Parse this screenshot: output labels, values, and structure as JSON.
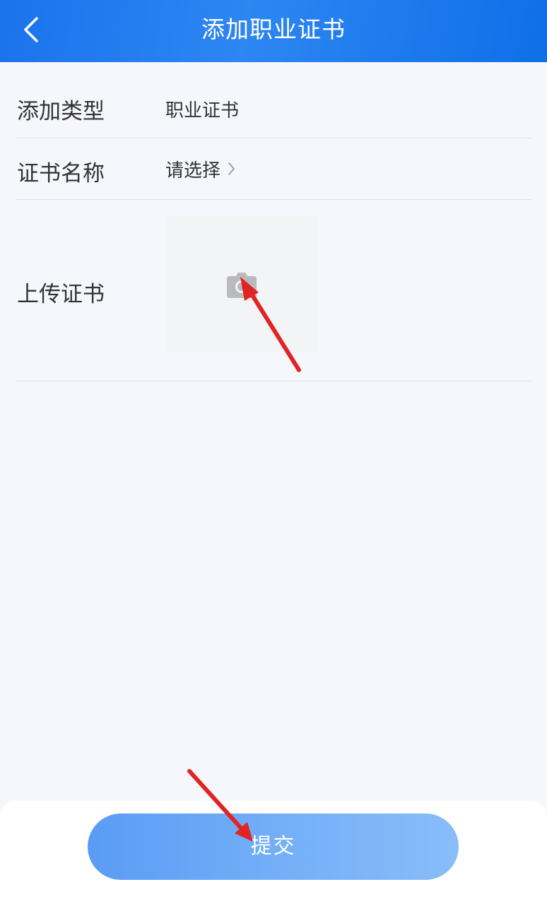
{
  "header": {
    "title": "添加职业证书",
    "back_icon": "chevron-left-icon"
  },
  "form": {
    "type_label": "添加类型",
    "type_value": "职业证书",
    "name_label": "证书名称",
    "name_placeholder": "请选择",
    "upload_label": "上传证书",
    "upload_icon": "camera-icon"
  },
  "footer": {
    "submit_label": "提交"
  },
  "colors": {
    "header": "#1a73ec",
    "background": "#f6f7fc",
    "submit_gradient_start": "#5a9cf5",
    "submit_gradient_end": "#88bdf9",
    "annotation_arrow": "#e02424"
  }
}
